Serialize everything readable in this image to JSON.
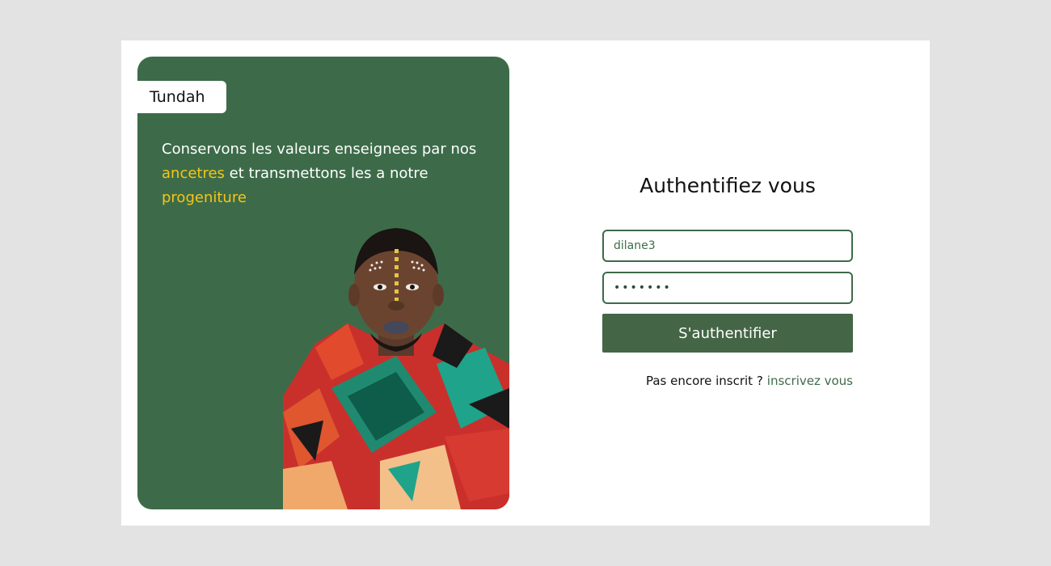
{
  "brand": {
    "name": "Tundah"
  },
  "tagline": {
    "part1": "Conservons les valeurs enseignees par nos ",
    "highlight1": "ancetres",
    "part2": " et transmettons les a notre ",
    "highlight2": "progeniture"
  },
  "login": {
    "title": "Authentifiez vous",
    "username_value": "dilane3",
    "password_value": "•••••••",
    "submit_label": "S'authentifier",
    "signup_prompt": "Pas encore inscrit ?",
    "signup_link": "inscrivez vous"
  },
  "colors": {
    "primary_green": "#3d6b49",
    "highlight_yellow": "#f5c518",
    "background": "#e3e3e3"
  }
}
